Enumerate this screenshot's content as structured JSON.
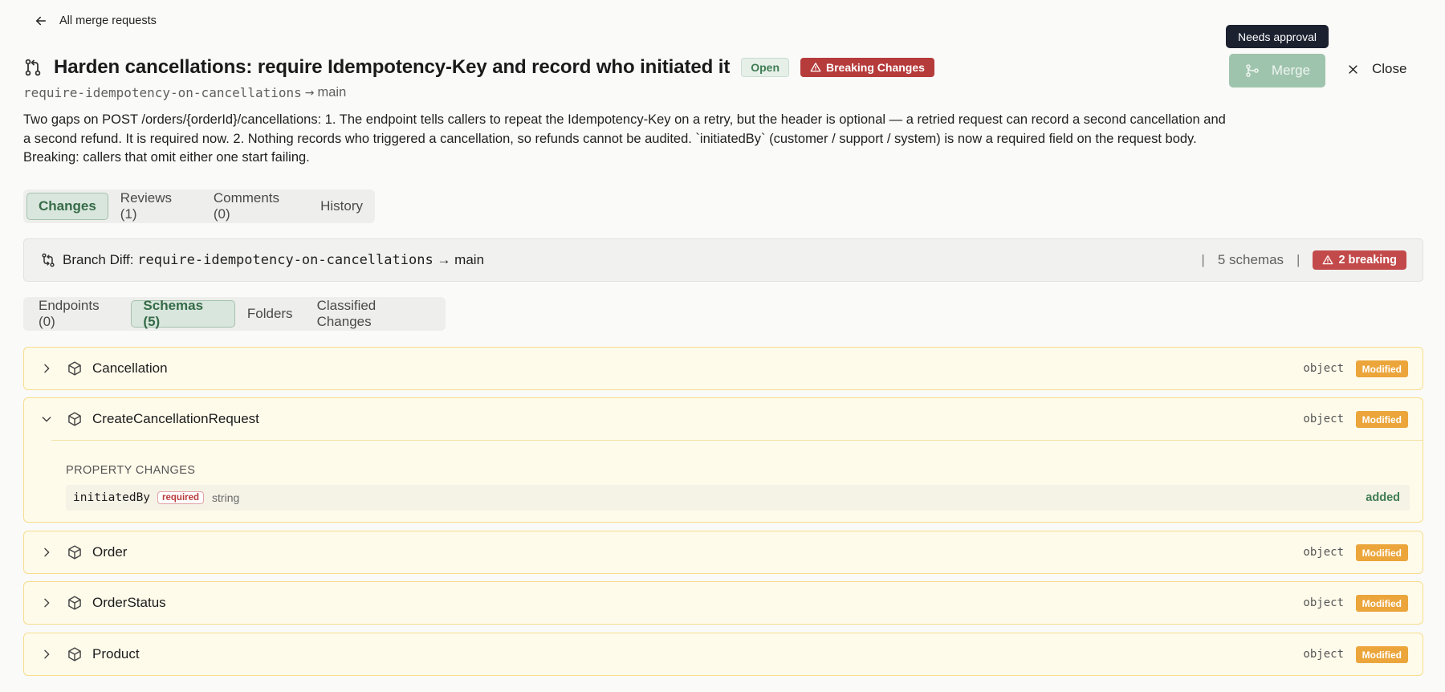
{
  "nav": {
    "back_label": "All merge requests"
  },
  "header": {
    "title": "Harden cancellations: require Idempotency-Key and record who initiated it",
    "status_badge": "Open",
    "breaking_badge": "Breaking Changes",
    "source_branch": "require-idempotency-on-cancellations",
    "arrow": "→",
    "target_branch": "main",
    "description": "Two gaps on POST /orders/{orderId}/cancellations: 1. The endpoint tells callers to repeat the Idempotency-Key on a retry, but the header is optional — a retried request can record a second cancellation and a second refund. It is required now. 2. Nothing records who triggered a cancellation, so refunds cannot be audited. `initiatedBy` (customer / support / system) is now a required field on the request body. Breaking: callers that omit either one start failing."
  },
  "actions": {
    "tooltip": "Needs approval",
    "merge_label": "Merge",
    "merge_enabled": false,
    "close_label": "Close"
  },
  "tabs": [
    {
      "label": "Changes",
      "active": true
    },
    {
      "label": "Reviews (1)",
      "active": false
    },
    {
      "label": "Comments (0)",
      "active": false
    },
    {
      "label": "History",
      "active": false
    }
  ],
  "diff_bar": {
    "prefix": "Branch Diff: ",
    "source_branch": "require-idempotency-on-cancellations",
    "arrow": "→",
    "target_branch": "main",
    "separator": "|",
    "schemas_count": "5 schemas",
    "breaking_count": "2 breaking"
  },
  "subtabs": [
    {
      "label": "Endpoints (0)",
      "active": false
    },
    {
      "label": "Schemas (5)",
      "active": true
    },
    {
      "label": "Folders",
      "active": false
    },
    {
      "label": "Classified Changes",
      "active": false
    }
  ],
  "schemas": [
    {
      "name": "Cancellation",
      "type": "object",
      "status": "Modified",
      "expanded": false
    },
    {
      "name": "CreateCancellationRequest",
      "type": "object",
      "status": "Modified",
      "expanded": true,
      "property_changes_heading": "PROPERTY CHANGES",
      "properties": [
        {
          "name": "initiatedBy",
          "required_label": "required",
          "type": "string",
          "change": "added"
        }
      ]
    },
    {
      "name": "Order",
      "type": "object",
      "status": "Modified",
      "expanded": false
    },
    {
      "name": "OrderStatus",
      "type": "object",
      "status": "Modified",
      "expanded": false
    },
    {
      "name": "Product",
      "type": "object",
      "status": "Modified",
      "expanded": false
    }
  ],
  "colors": {
    "accent_green": "#3f7d53",
    "breaking_red": "#b63b3b",
    "modified_orange": "#eba53a",
    "schema_row_bg": "#fffbeb",
    "schema_row_border": "#f7dd8c"
  }
}
